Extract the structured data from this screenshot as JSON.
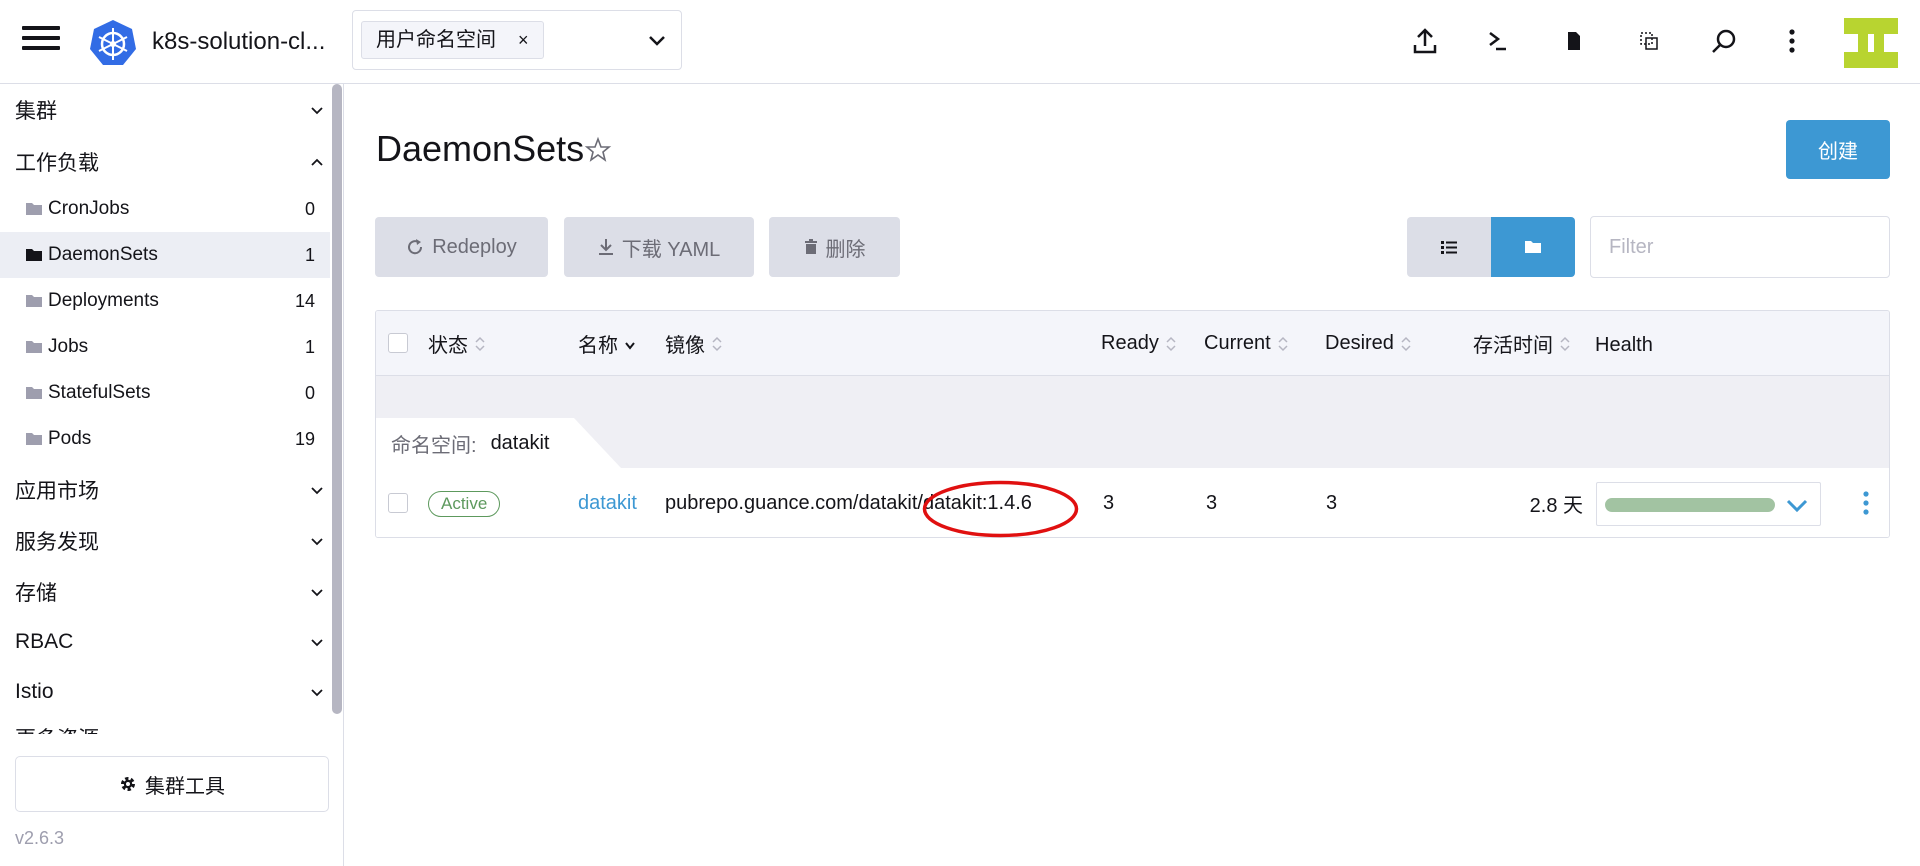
{
  "header": {
    "cluster_name": "k8s-solution-cl...",
    "namespace_chip": "用户命名空间",
    "namespace_chip_remove": "×",
    "icons": [
      "upload-icon",
      "terminal-icon",
      "file-icon",
      "copy-icon",
      "search-icon",
      "more-vertical-icon"
    ]
  },
  "sidebar": {
    "groups": {
      "cluster": "集群",
      "workloads": "工作负载",
      "apps": "应用市场",
      "service_discovery": "服务发现",
      "storage": "存储",
      "rbac": "RBAC",
      "istio": "Istio",
      "more": "更多资源"
    },
    "items": [
      {
        "label": "CronJobs",
        "count": "0"
      },
      {
        "label": "DaemonSets",
        "count": "1"
      },
      {
        "label": "Deployments",
        "count": "14"
      },
      {
        "label": "Jobs",
        "count": "1"
      },
      {
        "label": "StatefulSets",
        "count": "0"
      },
      {
        "label": "Pods",
        "count": "19"
      }
    ],
    "tools_button": "集群工具",
    "version": "v2.6.3"
  },
  "main": {
    "title": "DaemonSets",
    "create_button": "创建",
    "toolbar": {
      "redeploy": "Redeploy",
      "download_yaml": "下载 YAML",
      "delete": "删除"
    },
    "filter_placeholder": "Filter"
  },
  "table": {
    "columns": {
      "state": "状态",
      "name": "名称",
      "image": "镜像",
      "ready": "Ready",
      "current": "Current",
      "desired": "Desired",
      "age": "存活时间",
      "health": "Health"
    },
    "group": {
      "label": "命名空间:",
      "value": "datakit"
    },
    "rows": [
      {
        "state": "Active",
        "name": "datakit",
        "image": "pubrepo.guance.com/datakit/datakit:1.4.6",
        "ready": "3",
        "current": "3",
        "desired": "3",
        "age": "2.8 天"
      }
    ]
  },
  "colors": {
    "accent": "#3d98d3",
    "active_badge": "#5d995d",
    "health_bar": "#a2c3a2",
    "annotation": "#e01010"
  }
}
